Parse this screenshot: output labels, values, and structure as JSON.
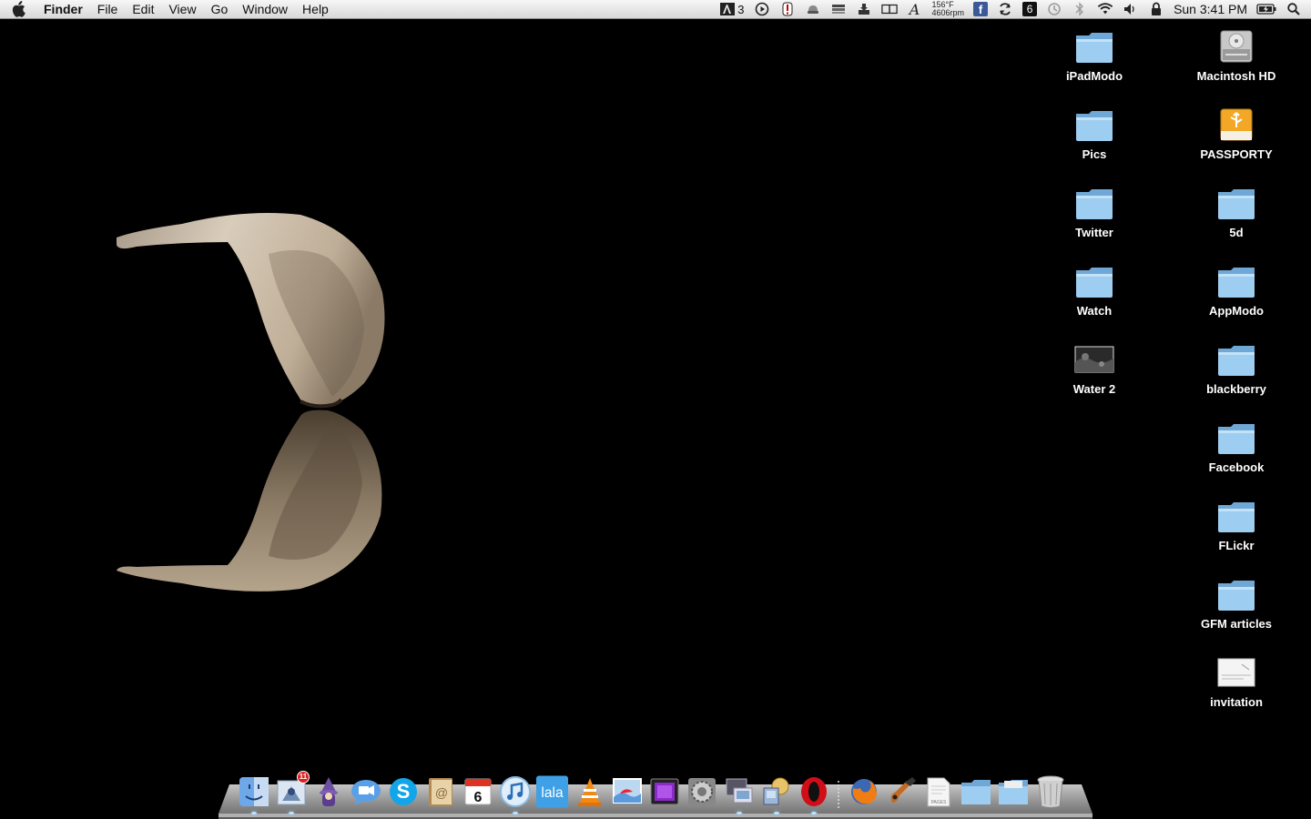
{
  "menubar": {
    "app_name": "Finder",
    "menus": [
      "File",
      "Edit",
      "View",
      "Go",
      "Window",
      "Help"
    ],
    "status": {
      "adobe_count": "3",
      "temp_line1": "156°F",
      "temp_line2": "4606rpm",
      "facebook_glyph": "f",
      "growl_glyph": "6",
      "clock": "Sun 3:41 PM"
    }
  },
  "desktop": {
    "icons": [
      {
        "label": "iPadModo",
        "kind": "folder"
      },
      {
        "label": "Macintosh HD",
        "kind": "hard-drive"
      },
      {
        "label": "Pics",
        "kind": "folder"
      },
      {
        "label": "PASSPORTY",
        "kind": "usb-drive"
      },
      {
        "label": "Twitter",
        "kind": "folder"
      },
      {
        "label": "5d",
        "kind": "folder"
      },
      {
        "label": "Watch",
        "kind": "folder"
      },
      {
        "label": "AppModo",
        "kind": "folder"
      },
      {
        "label": "Water 2",
        "kind": "image"
      },
      {
        "label": "blackberry",
        "kind": "folder"
      },
      {
        "label": "Facebook",
        "kind": "folder"
      },
      {
        "label": "FLickr",
        "kind": "folder"
      },
      {
        "label": "GFM articles",
        "kind": "folder"
      },
      {
        "label": "invitation",
        "kind": "document"
      }
    ]
  },
  "dock": {
    "mail_badge": "11",
    "calendar_day": "6",
    "lala_label": "lala",
    "pages_label": "PAGES",
    "skype_glyph": "S",
    "apps": [
      "finder",
      "mail",
      "wizard",
      "ichat",
      "skype",
      "address-book",
      "ical",
      "itunes",
      "lala",
      "vlc",
      "iphoto",
      "photo-booth",
      "system-preferences",
      "remote-desktop",
      "network-utility",
      "opera",
      "firefox",
      "garageband",
      "pages",
      "documents-stack",
      "downloads-stack",
      "trash"
    ]
  },
  "colors": {
    "folder": "#8ec5ea",
    "menubar": "#e4e4e4",
    "garlic": "#cbbba5"
  }
}
